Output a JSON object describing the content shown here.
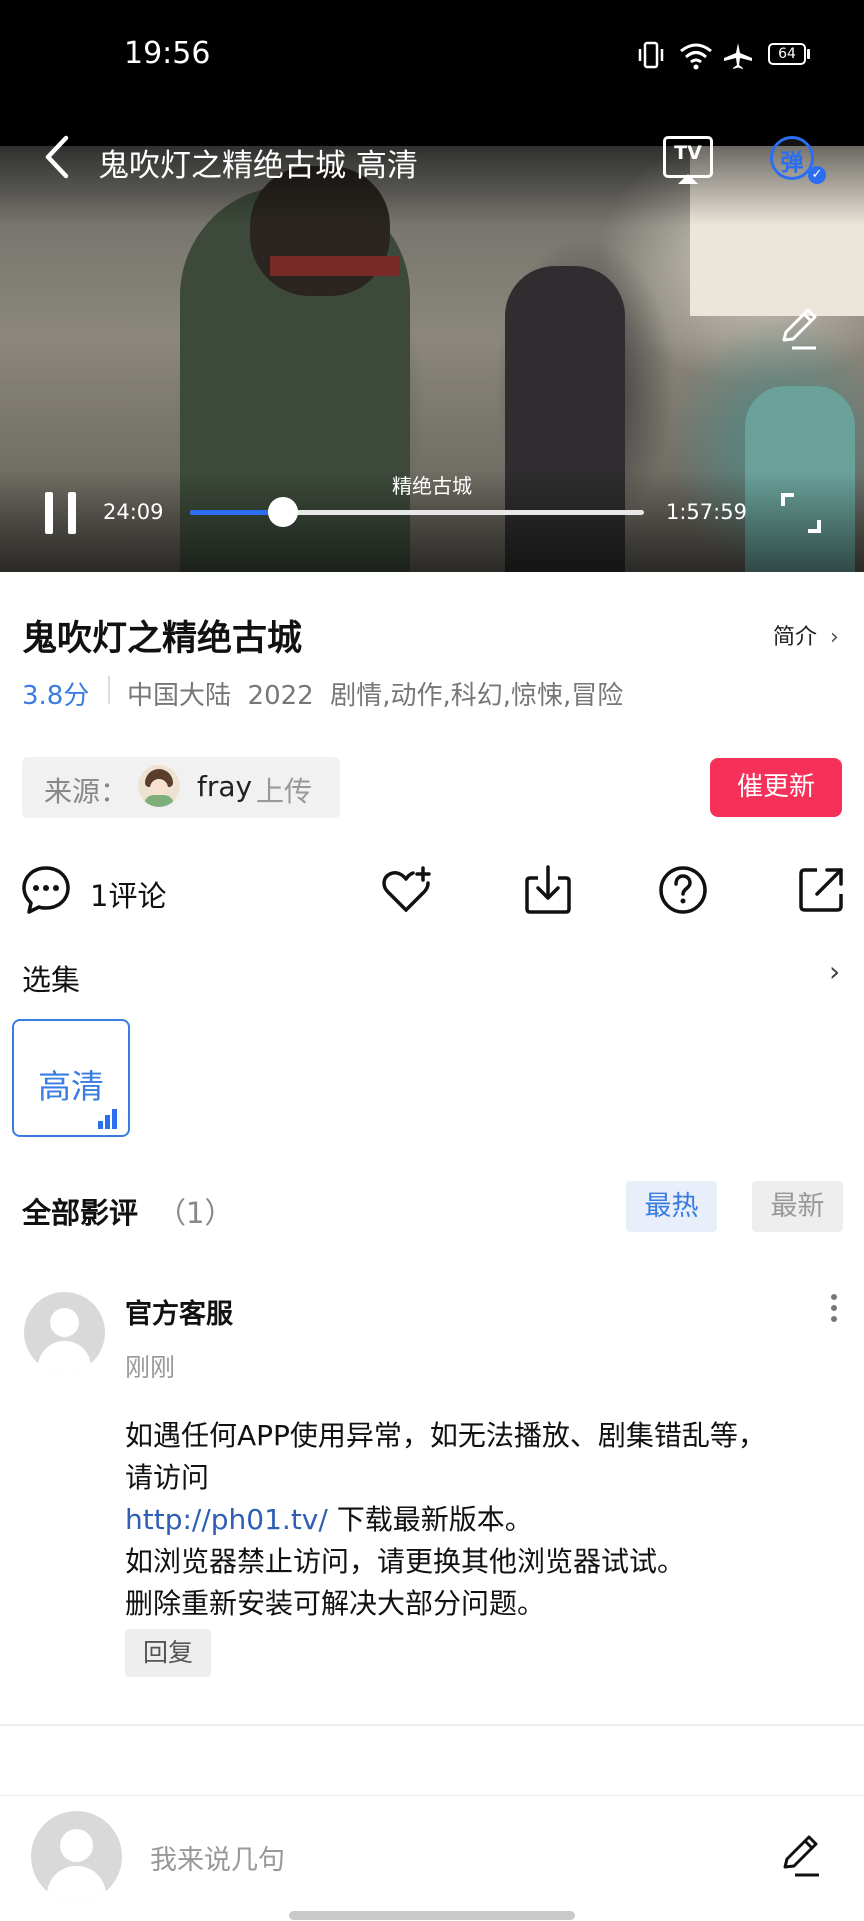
{
  "status_bar": {
    "time": "19:56",
    "battery": "64"
  },
  "player": {
    "title": "鬼吹灯之精绝古城 高清",
    "episode_caption": "精绝古城",
    "elapsed": "24:09",
    "duration": "1:57:59",
    "progress": 0.204,
    "danmaku_label": "弹",
    "cast_label": "TV"
  },
  "info": {
    "title": "鬼吹灯之精绝古城",
    "intro_label": "简介",
    "rating": "3.8分",
    "meta": "中国大陆  2022  剧情,动作,科幻,惊悚,冒险",
    "source_label": "来源：",
    "source_user": "fray",
    "source_suffix": "上传",
    "urge_button": "催更新"
  },
  "actions": {
    "comment_count": "1评论"
  },
  "episodes": {
    "label": "选集",
    "items": [
      "高清"
    ]
  },
  "reviews": {
    "title": "全部影评",
    "count": "（1）",
    "sort_hot": "最热",
    "sort_new": "最新",
    "items": [
      {
        "name": "官方客服",
        "time": "刚刚",
        "line1": "如遇任何APP使用异常，如无法播放、剧集错乱等，",
        "line2": "请访问",
        "link": "http://ph01.tv/",
        "line3_suffix": " 下载最新版本。",
        "line4": "如浏览器禁止访问，请更换其他浏览器试试。",
        "line5": "删除重新安装可解决大部分问题。",
        "reply": "回复"
      }
    ]
  },
  "comment_input": {
    "placeholder": "我来说几句"
  },
  "colors": {
    "accent": "#3a7de0",
    "urge": "#f5315a",
    "progress": "#2b6ef0"
  }
}
